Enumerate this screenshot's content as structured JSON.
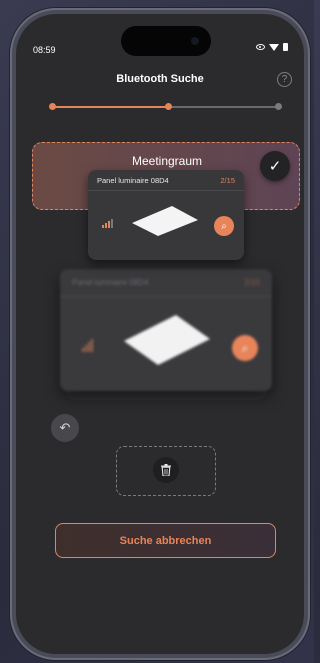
{
  "status_bar": {
    "time": "08:59",
    "icons": [
      "eye-icon",
      "wifi-icon",
      "battery-icon"
    ]
  },
  "header": {
    "title": "Bluetooth Suche",
    "help_icon": "?"
  },
  "stepper": {
    "steps_total": 3,
    "current_step": 2
  },
  "room": {
    "name": "Meetingraum",
    "check_icon": "✓"
  },
  "panel_card": {
    "name": "Panel luminaire 08D4",
    "count": "2/15"
  },
  "ghost_card": {
    "name": "Panel luminaire 08D4",
    "count": "2/15"
  },
  "actions": {
    "undo_icon": "↶",
    "trash_icon": "🗑",
    "cancel_label": "Suche abbrechen"
  },
  "colors": {
    "accent": "#e2855a",
    "background": "#2b2b2e",
    "card": "#38383b"
  }
}
